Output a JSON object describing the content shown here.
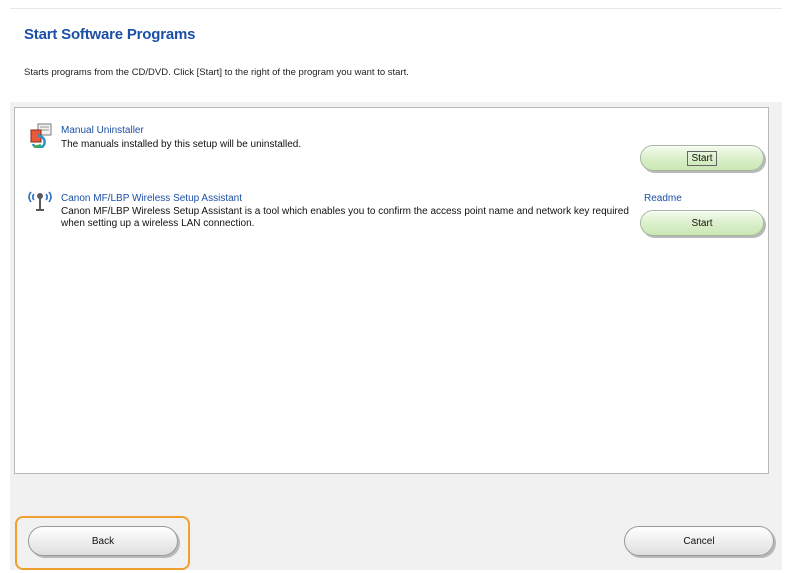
{
  "header": {
    "title": "Start Software Programs",
    "subtitle": "Starts programs from the CD/DVD. Click [Start] to the right of the program you want to start."
  },
  "programs": [
    {
      "icon": "manual-uninstaller-icon",
      "name": "Manual Uninstaller",
      "description": "The manuals installed by this setup will be uninstalled.",
      "start_label": "Start"
    },
    {
      "icon": "wireless-antenna-icon",
      "name": "Canon MF/LBP Wireless Setup Assistant",
      "description": "Canon MF/LBP Wireless Setup Assistant is a tool which enables you to confirm the access point name and network key required when setting up a wireless LAN connection.",
      "readme_label": "Readme",
      "start_label": "Start"
    }
  ],
  "footer": {
    "back_label": "Back",
    "cancel_label": "Cancel"
  },
  "colors": {
    "title_blue": "#1c4fa6",
    "start_button_green": "#d9efc8",
    "highlight_orange": "#f0a030"
  }
}
